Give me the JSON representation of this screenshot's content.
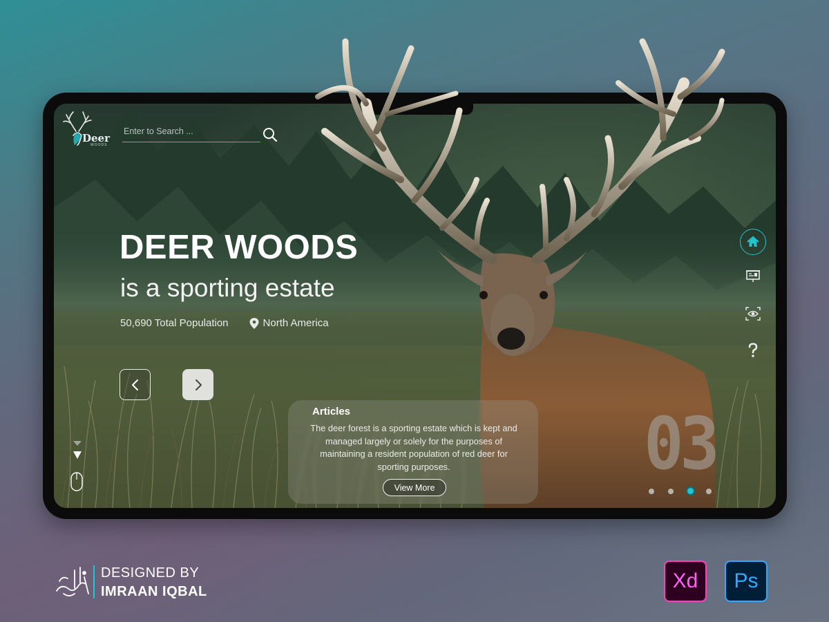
{
  "brand": {
    "logo_text": "Deer",
    "logo_sub": "WOODS"
  },
  "search": {
    "placeholder": "Enter to Search ...",
    "value": "",
    "icon": "search-icon"
  },
  "hero": {
    "title": "DEER WOODS",
    "subtitle": "is a sporting estate",
    "population": "50,690 Total Population",
    "location": "North America"
  },
  "carousel": {
    "prev_icon": "chevron-left-icon",
    "next_icon": "chevron-right-icon",
    "slide_number": "03",
    "total_slides": 4,
    "active_slide_index": 3
  },
  "side_nav": {
    "items": [
      {
        "icon": "home-icon",
        "active": true
      },
      {
        "icon": "presentation-icon",
        "active": false
      },
      {
        "icon": "eye-scan-icon",
        "active": false
      },
      {
        "icon": "question-icon",
        "active": false
      }
    ]
  },
  "articles": {
    "title": "Articles",
    "body": "The deer forest is a sporting estate which is kept and managed largely or solely for the purposes of maintaining a resident population of red deer for sporting purposes.",
    "button_label": "View More"
  },
  "credit": {
    "line1": "DESIGNED BY",
    "line2": "IMRAAN IQBAL"
  },
  "tools": {
    "xd_label": "Xd",
    "ps_label": "Ps"
  },
  "colors": {
    "accent": "#25c3cf",
    "xd_pink": "#ff61f6",
    "ps_blue": "#31a8ff"
  }
}
